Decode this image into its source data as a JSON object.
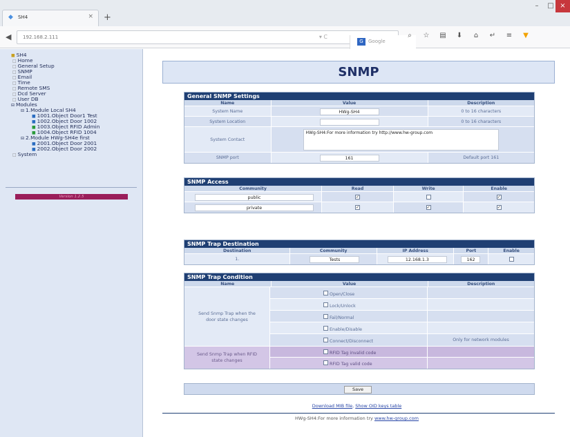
{
  "browser": {
    "tab_title": "SH4",
    "url": "192.168.2.111",
    "search_engine": "Google",
    "icons": [
      "search-icon",
      "star-icon",
      "reader-icon",
      "download-icon",
      "home-icon",
      "share-icon",
      "menu-icon",
      "extension-icon"
    ]
  },
  "tree": {
    "items": [
      {
        "label": "SH4",
        "icon": "folder-icon"
      },
      {
        "label": "Home",
        "icon": "page-icon"
      },
      {
        "label": "General Setup",
        "icon": "page-icon"
      },
      {
        "label": "SNMP",
        "icon": "page-icon"
      },
      {
        "label": "Email",
        "icon": "page-icon"
      },
      {
        "label": "Time",
        "icon": "page-icon"
      },
      {
        "label": "Remote SMS",
        "icon": "page-icon"
      },
      {
        "label": "Dcd Server",
        "icon": "page-icon"
      },
      {
        "label": "User DB",
        "icon": "page-icon"
      },
      {
        "label": "Modules",
        "icon": "expand-icon"
      },
      {
        "label": "1.Module Local SH4",
        "icon": "expand-icon"
      },
      {
        "label": "1001.Object Door1 Test",
        "icon": "door-icon"
      },
      {
        "label": "1002.Object Door 1002",
        "icon": "door-icon"
      },
      {
        "label": "1003.Object RFID Admin",
        "icon": "rfid-icon"
      },
      {
        "label": "1004.Object RFID 1004",
        "icon": "rfid-icon"
      },
      {
        "label": "2.Module HWg-SH4e first",
        "icon": "expand-icon"
      },
      {
        "label": "2001.Object Door 2001",
        "icon": "door-icon"
      },
      {
        "label": "2002.Object Door 2002",
        "icon": "door-icon"
      },
      {
        "label": "System",
        "icon": "page-icon"
      }
    ],
    "version": "Version 1.2.5"
  },
  "page": {
    "title": "SNMP"
  },
  "general": {
    "title": "General SNMP Settings",
    "headers": [
      "Name",
      "Value",
      "Description"
    ],
    "rows": {
      "name": {
        "label": "System Name",
        "value": "HWg-SH4",
        "desc": "0 to 16 characters"
      },
      "location": {
        "label": "System Location",
        "value": "",
        "desc": "0 to 16 characters"
      },
      "contact": {
        "label": "System Contact",
        "value": "HWg-SH4:For more information try http://www.hw-group.com"
      },
      "port": {
        "label": "SNMP port",
        "value": "161",
        "desc": "Default port 161"
      }
    }
  },
  "access": {
    "title": "SNMP Access",
    "headers": [
      "Community",
      "Read",
      "Write",
      "Enable"
    ],
    "rows": [
      {
        "community": "public",
        "read": "✓",
        "write": "",
        "enable": "✓"
      },
      {
        "community": "private",
        "read": "✓",
        "write": "✓",
        "enable": "✓"
      }
    ]
  },
  "trap_dest": {
    "title": "SNMP Trap Destination",
    "headers": [
      "Destination",
      "Community",
      "IP Address",
      "Port",
      "Enable"
    ],
    "row": {
      "dest": "1.",
      "community": "Tests",
      "ip": "12.168.1.3",
      "port": "162",
      "enable": ""
    }
  },
  "trap_cond": {
    "title": "SNMP Trap Condition",
    "headers": [
      "Name",
      "Value",
      "Description"
    ],
    "door_label": "Send Snmp Trap when the door state changes",
    "door_opts": [
      "Open/Close",
      "Lock/Unlock",
      "Fail/Normal",
      "Enable/Disable",
      "Connect/Disconnect"
    ],
    "connect_desc": "Only for network modules",
    "rfid_label": "Send Snmp Trap when RFID state changes",
    "rfid_opts": [
      "RFID Tag invalid code",
      "RFID Tag valid code"
    ]
  },
  "save_label": "Save",
  "links": {
    "mib": "Download MIB file",
    "sep": ", ",
    "oid": "Show OID keys table"
  },
  "footer": {
    "text": "HWg-SH4:For more information try ",
    "link": "www.hw-group.com"
  }
}
